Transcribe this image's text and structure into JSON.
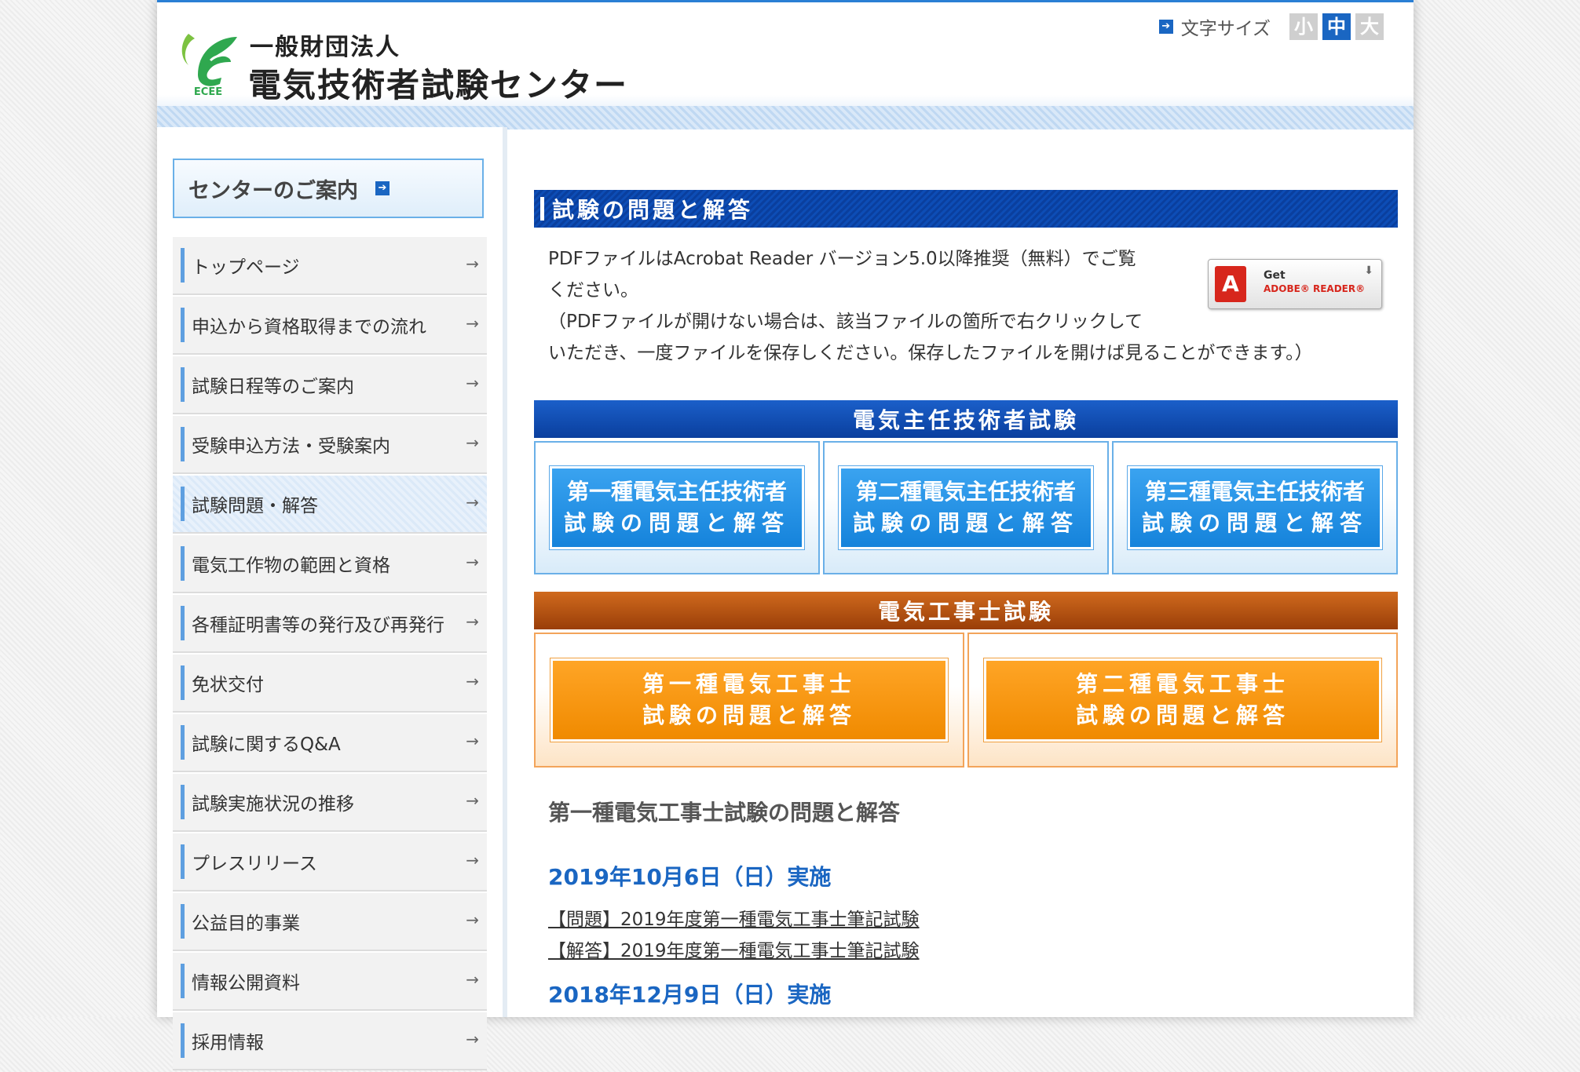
{
  "header": {
    "org_type": "一般財団法人",
    "org_name": "電気技術者試験センター",
    "logo_text": "ECEE",
    "font_size": {
      "label": "文字サイズ",
      "options": [
        "小",
        "中",
        "大"
      ],
      "selected": "中"
    }
  },
  "sidebar": {
    "center_guide": "センターのご案内",
    "items": [
      {
        "label": "トップページ"
      },
      {
        "label": "申込から資格取得までの流れ"
      },
      {
        "label": "試験日程等のご案内"
      },
      {
        "label": "受験申込方法・受験案内"
      },
      {
        "label": "試験問題・解答"
      },
      {
        "label": "電気工作物の範囲と資格"
      },
      {
        "label": "各種証明書等の発行及び再発行"
      },
      {
        "label": "免状交付"
      },
      {
        "label": "試験に関するQ&A"
      },
      {
        "label": "試験実施状況の推移"
      },
      {
        "label": "プレスリリース"
      },
      {
        "label": "公益目的事業"
      },
      {
        "label": "情報公開資料"
      },
      {
        "label": "採用情報"
      }
    ],
    "active_item": "試験問題・解答"
  },
  "main": {
    "section_title": "試験の問題と解答",
    "pdf_note_line1": "PDFファイルはAcrobat Reader バージョン5.0以降推奨（無料）でご覧",
    "pdf_note_line2": "ください。",
    "pdf_note_line3": "（PDFファイルが開けない場合は、該当ファイルの箇所で右クリックして",
    "pdf_note_line4": "いただき、一度ファイルを保存しください。保存したファイルを開けば見ることができます。）",
    "adobe_badge": {
      "get": "Get",
      "reader": "ADOBE® READER®"
    },
    "chief_engineer": {
      "title": "電気主任技術者試験",
      "buttons": [
        {
          "line1": "第一種電気主任技術者",
          "line2": "試験の問題と解答"
        },
        {
          "line1": "第二種電気主任技術者",
          "line2": "試験の問題と解答"
        },
        {
          "line1": "第三種電気主任技術者",
          "line2": "試験の問題と解答"
        }
      ]
    },
    "electrician": {
      "title": "電気工事士試験",
      "buttons": [
        {
          "line1": "第一種電気工事士",
          "line2": "試験の問題と解答"
        },
        {
          "line1": "第二種電気工事士",
          "line2": "試験の問題と解答"
        }
      ]
    },
    "sub_heading": "第一種電気工事士試験の問題と解答",
    "exam_dates": [
      {
        "date": "2019年10月6日（日）実施",
        "links": [
          "【問題】2019年度第一種電気工事士筆記試験",
          "【解答】2019年度第一種電気工事士筆記試験"
        ]
      },
      {
        "date": "2018年12月9日（日）実施",
        "links": []
      }
    ]
  },
  "colors": {
    "accent_blue": "#1a66c2",
    "header_bar_blue": "#0a3f9e",
    "orange": "#f08a00",
    "logo_green": "#2fa84f"
  }
}
